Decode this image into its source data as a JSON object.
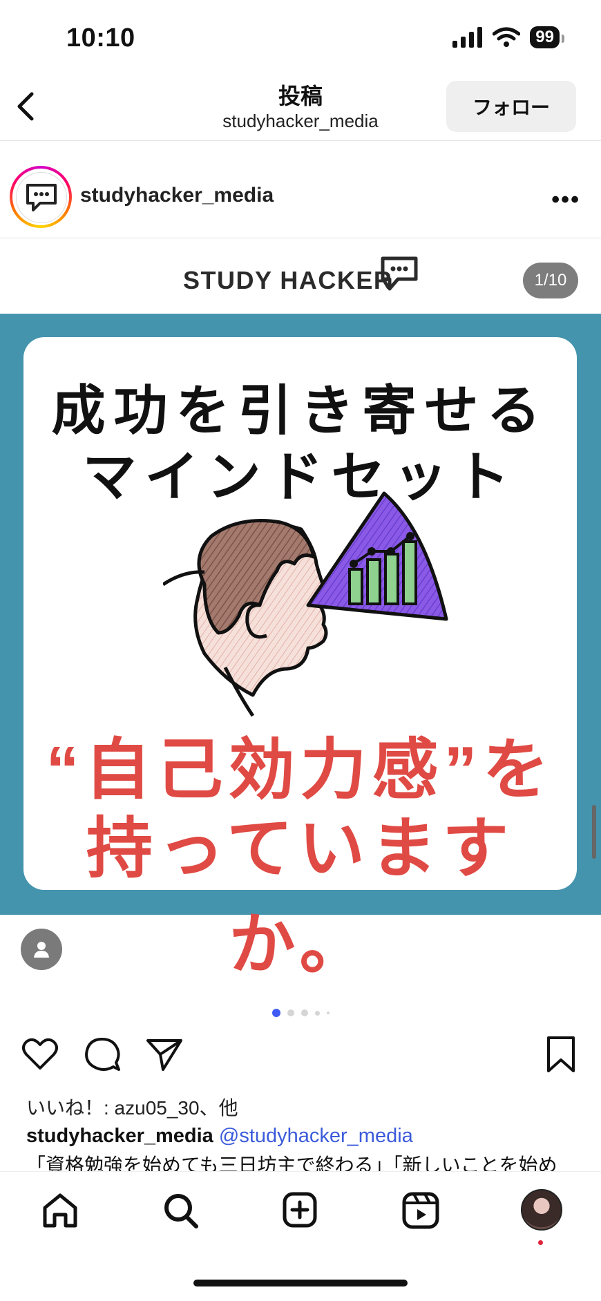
{
  "status_bar": {
    "time": "10:10",
    "battery": "99"
  },
  "header": {
    "title": "投稿",
    "subtitle": "studyhacker_media",
    "follow_label": "フォロー"
  },
  "post": {
    "username": "studyhacker_media",
    "brand_logo": "STUDY HACKER",
    "counter": "1/10",
    "image_lines": {
      "line1": "成功を引き寄せる",
      "line2": "マインドセット",
      "line3": "“自己効力感”を",
      "line4": "持っていますか。"
    },
    "likes": "いいね！: azu05_30、他",
    "caption_user": "studyhacker_media",
    "caption_mention": "@studyhacker_media",
    "caption_text": "「資格勉強を始めても三日坊主で終わる」「新しいことを始め"
  },
  "colors": {
    "accent": "#3f5bf6",
    "image_bg": "#4594ad",
    "headline_red": "#e04a44"
  },
  "icons": [
    "back-icon",
    "more-icon",
    "heart-icon",
    "comment-icon",
    "share-icon",
    "bookmark-icon",
    "home-icon",
    "search-icon",
    "create-icon",
    "reels-icon"
  ]
}
